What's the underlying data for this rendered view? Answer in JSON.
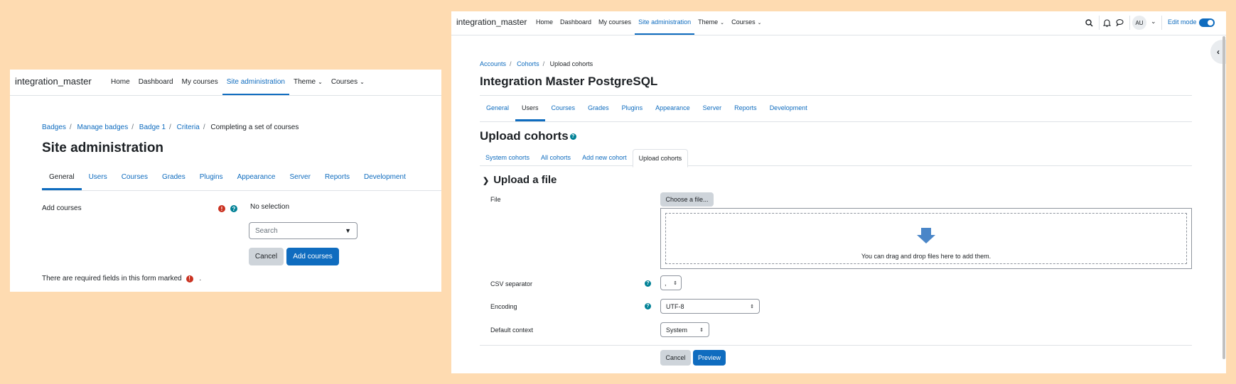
{
  "left": {
    "brand": "integration_master",
    "nav": [
      "Home",
      "Dashboard",
      "My courses",
      "Site administration",
      "Theme",
      "Courses"
    ],
    "breadcrumb": [
      "Badges",
      "Manage badges",
      "Badge 1",
      "Criteria",
      "Completing a set of courses"
    ],
    "page_title": "Site administration",
    "tabs": [
      "General",
      "Users",
      "Courses",
      "Grades",
      "Plugins",
      "Appearance",
      "Server",
      "Reports",
      "Development"
    ],
    "form": {
      "add_courses_label": "Add courses",
      "no_selection": "No selection",
      "search_placeholder": "Search",
      "cancel": "Cancel",
      "submit": "Add courses",
      "required_note": "There are required fields in this form marked",
      "required_note_end": "."
    }
  },
  "right": {
    "brand": "integration_master",
    "nav": [
      "Home",
      "Dashboard",
      "My courses",
      "Site administration",
      "Theme",
      "Courses"
    ],
    "avatar": "AU",
    "edit_mode": "Edit mode",
    "edit_mode_on": true,
    "breadcrumb": [
      "Accounts",
      "Cohorts",
      "Upload cohorts"
    ],
    "page_title": "Integration Master PostgreSQL",
    "tabs": [
      "General",
      "Users",
      "Courses",
      "Grades",
      "Plugins",
      "Appearance",
      "Server",
      "Reports",
      "Development"
    ],
    "section_title": "Upload cohorts",
    "subtabs": [
      "System cohorts",
      "All cohorts",
      "Add new cohort",
      "Upload cohorts"
    ],
    "fieldset_title": "Upload a file",
    "fields": {
      "file_label": "File",
      "choose_file": "Choose a file...",
      "dropzone_text": "You can drag and drop files here to add them.",
      "csv_label": "CSV separator",
      "csv_value": ",",
      "encoding_label": "Encoding",
      "encoding_value": "UTF-8",
      "context_label": "Default context",
      "context_value": "System"
    },
    "cancel": "Cancel",
    "preview": "Preview"
  },
  "colors": {
    "background": "#fedbb1",
    "accent": "#0f6cbf",
    "info": "#008196",
    "required": "#ca3120"
  }
}
